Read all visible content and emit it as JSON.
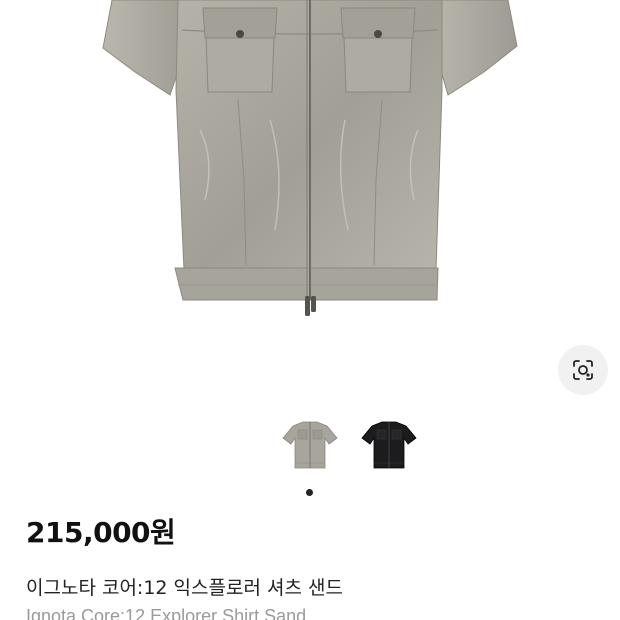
{
  "product": {
    "price": "215,000원",
    "name_ko": "이그노타 코어:12 익스플로러 셔츠 샌드",
    "name_en": "Ignota Core:12 Explorer Shirt Sand",
    "main_image": "sand-shirt-front-photo",
    "selected_variant_index": 0,
    "variants": [
      {
        "color": "#a8a59c",
        "icon": "sand-shirt-thumbnail"
      },
      {
        "color": "#1c1c1e",
        "icon": "black-shirt-thumbnail"
      }
    ]
  },
  "controls": {
    "lens_icon": "image-search-icon"
  },
  "carousel": {
    "page_count": 1,
    "active_page": 1
  }
}
